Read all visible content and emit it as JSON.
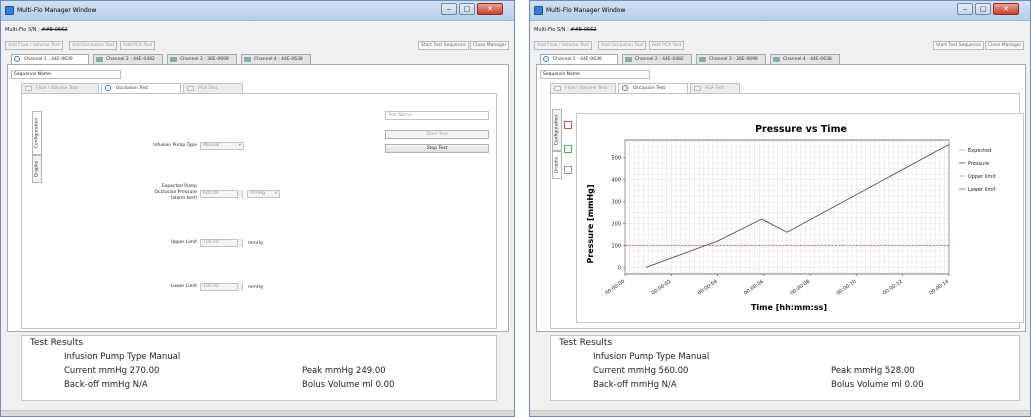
{
  "left": {
    "title": "Multi-Flo Manager Window",
    "serial_label": "Multi-Flo S/N :",
    "serial_value": "##E-0662",
    "toolbar": {
      "add_flow": "Add Flow / Volume Test",
      "add_occlusion": "Add Occlusion Test",
      "add_pca": "Add PCA Test",
      "start_sequence": "Start Test Sequence",
      "close_manager": "Close Manager"
    },
    "channels": [
      "Channel 1 : 44E-0639",
      "Channel 2 : 44E-0482",
      "Channel 3 : 36E-0699",
      "Channel 4 : 44E-0638"
    ],
    "sequence_placeholder": "Sequence Name",
    "test_tabs": [
      "Flow / Volume Test",
      "Occlusion Test",
      "PCA Test"
    ],
    "side_tabs": [
      "Configuration",
      "Graphs"
    ],
    "form": {
      "pump_type_label": "Infusion Pump Type",
      "pump_type_value": "Manual",
      "pressure_label_1": "Expected Pump",
      "pressure_label_2": "Occlusion Pressure",
      "pressure_label_3": "(alarm test)",
      "pressure_value": "600.00",
      "pressure_unit": "mmHg",
      "upper_label": "Upper Limit",
      "upper_value": "700.00",
      "upper_unit": "mmHg",
      "lower_label": "Lower Limit",
      "lower_value": "100.00",
      "lower_unit": "mmHg"
    },
    "right_panel": {
      "test_name_placeholder": "Test Name",
      "start_test": "Start Test",
      "stop_test": "Stop Test"
    },
    "results": {
      "title": "Test Results",
      "pump_type": "Infusion Pump Type Manual",
      "current": "Current mmHg 270.00",
      "peak": "Peak mmHg 249.00",
      "backoff": "Back-off mmHg N/A",
      "bolus": "Bolus Volume ml 0.00"
    }
  },
  "right": {
    "title": "Multi-Flo Manager Window",
    "serial_label": "Multi-Flo S/N :",
    "serial_value": "##E-0662",
    "toolbar": {
      "add_flow": "Add Flow / Volume Test",
      "add_occlusion": "Add Occlusion Test",
      "add_pca": "Add PCA Test",
      "start_sequence": "Start Test Sequence",
      "close_manager": "Close Manager"
    },
    "channels": [
      "Channel 1 : 44E-0639",
      "Channel 2 : 44E-0482",
      "Channel 3 : 36E-0699",
      "Channel 4 : 44E-0638"
    ],
    "sequence_placeholder": "Sequence Name",
    "test_tabs": [
      "Flow / Volume Test",
      "Occlusion Test",
      "PCA Test"
    ],
    "side_tabs": [
      "Configuration",
      "Graphs"
    ],
    "results": {
      "title": "Test Results",
      "pump_type": "Infusion Pump Type Manual",
      "current": "Current mmHg 560.00",
      "peak": "Peak mmHg 528.00",
      "backoff": "Back-off mmHg N/A",
      "bolus": "Bolus Volume ml 0.00"
    }
  },
  "chart_data": {
    "type": "line",
    "title": "Pressure vs Time",
    "xlabel": "Time [hh:mm:ss]",
    "ylabel": "Pressure [mmHg]",
    "x_ticks": [
      "00:00:00",
      "00:00:02",
      "00:00:04",
      "00:00:06",
      "00:00:08",
      "00:00:10",
      "00:00:12",
      "00:00:14"
    ],
    "y_ticks": [
      0,
      100,
      200,
      300,
      400,
      500
    ],
    "xlim": [
      0,
      14
    ],
    "ylim": [
      -30,
      580
    ],
    "grid": true,
    "legend_position": "right",
    "legend": [
      "Expected",
      "Pressure",
      "Upper limit",
      "Lower limit"
    ],
    "series": [
      {
        "name": "Pressure",
        "color": "#555555",
        "x": [
          0.9,
          4,
          5.9,
          7,
          14
        ],
        "y": [
          0,
          120,
          220,
          160,
          560
        ]
      },
      {
        "name": "Lower limit",
        "color": "#e05050",
        "x": [
          0,
          14
        ],
        "y": [
          100,
          100
        ]
      }
    ]
  }
}
